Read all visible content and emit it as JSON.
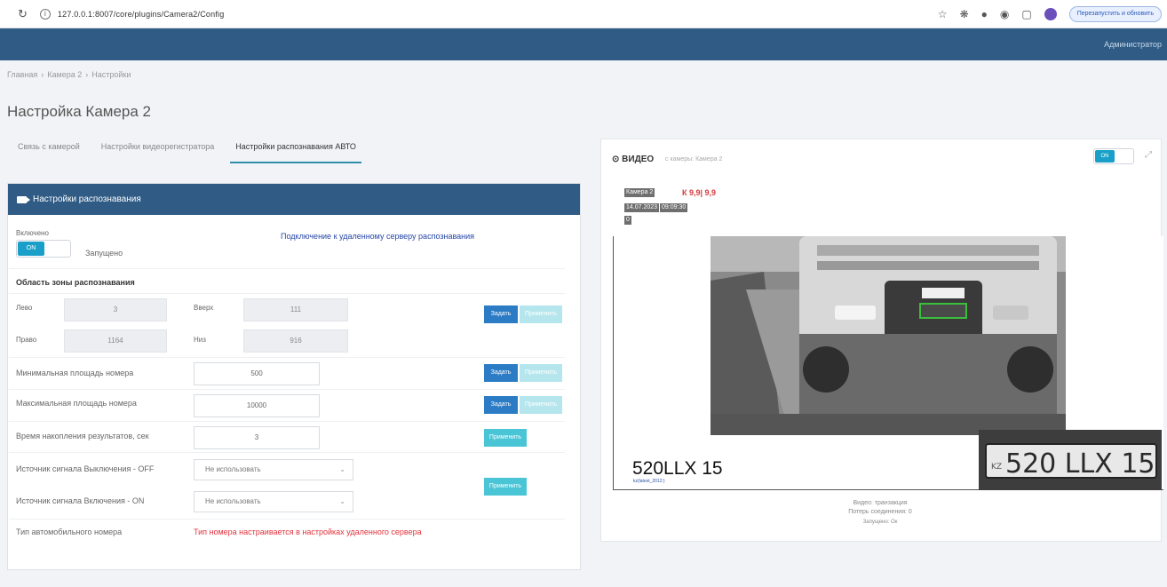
{
  "browser": {
    "url": "127.0.0.1:8007/core/plugins/Camera2/Config",
    "update_label": "Перезапустить и обновить"
  },
  "header": {
    "admin_label": "Администратор"
  },
  "breadcrumb": [
    "Главная",
    "Камера 2",
    "Настройки"
  ],
  "page_title": "Настройка Камера 2",
  "tabs": [
    {
      "label": "Связь с камерой",
      "active": false
    },
    {
      "label": "Настройки видеорегистратора",
      "active": false
    },
    {
      "label": "Настройки распознавания АВТО",
      "active": true
    }
  ],
  "recognition": {
    "panel_title": "Настройки распознавания",
    "enabled_label": "Включено",
    "toggle_on": "ON",
    "status": "Запущено",
    "remote_link": "Подключение к удаленному серверу распознавания",
    "zone_title": "Область зоны распознавания",
    "left_label": "Лево",
    "left_value": "3",
    "top_label": "Вверх",
    "top_value": "111",
    "right_label": "Право",
    "right_value": "1164",
    "bottom_label": "Низ",
    "bottom_value": "916",
    "set_label": "Задать",
    "apply_label": "Применить",
    "min_area_label": "Минимальная площадь номера",
    "min_area_value": "500",
    "max_area_label": "Максимальная площадь номера",
    "max_area_value": "10000",
    "accum_label": "Время накопления результатов, сек",
    "accum_value": "3",
    "off_source_label": "Источник сигнала Выключения - OFF",
    "off_source_value": "Не использовать",
    "on_source_label": "Источник сигнала Включения - ON",
    "on_source_value": "Не использовать",
    "plate_type_label": "Тип автомобильного номера",
    "plate_type_warning": "Тип номера настраивается в настройках удаленного сервера"
  },
  "video": {
    "title": "ВИДЕО",
    "subtitle": "с камеры: Камера 2",
    "toggle_on": "ON",
    "overlay_cam": "Камера 2",
    "overlay_red": "К  9,9| 9,9",
    "overlay_date": "14.07.2023",
    "overlay_time": "09:09:30",
    "overlay_small": "0",
    "plate_text": "520LLX 15",
    "plate_sub": "kz(latest_2012:)",
    "plate_image_text": "520 LLX 15",
    "plate_country": "KZ",
    "status_lines": [
      "Видео: транзакция",
      "Потерь соединения: 0",
      "Запущено: Ок"
    ]
  },
  "colors": {
    "header": "#2f5b85",
    "accent": "#1aa0c8",
    "warning": "#e0323b"
  }
}
